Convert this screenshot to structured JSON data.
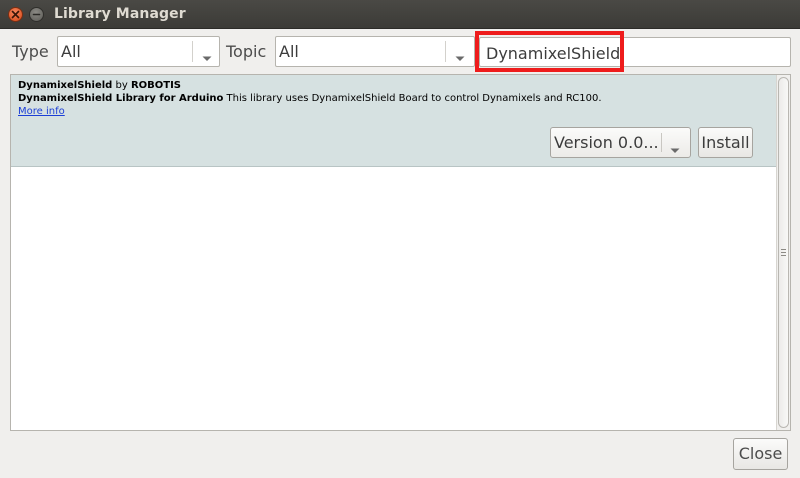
{
  "window": {
    "title": "Library Manager"
  },
  "filters": {
    "type_label": "Type",
    "type_value": "All",
    "topic_label": "Topic",
    "topic_value": "All",
    "search_value": "DynamixelShield"
  },
  "library": {
    "name": "DynamixelShield",
    "by": " by ",
    "author": "ROBOTIS",
    "sentence": "DynamixelShield Library for Arduino",
    "description": " This library uses DynamixelShield Board to control Dynamixels and RC100.",
    "more_info": "More info",
    "version_selected": "Version 0.0...",
    "install_label": "Install"
  },
  "footer": {
    "close_label": "Close"
  },
  "colors": {
    "highlight_box": "#ee1c1c",
    "selected_row": "#d6e1e1",
    "link": "#1c3fd6",
    "titlebar": "#3c3b37"
  },
  "icons": [
    "window-close-icon",
    "window-minimize-icon",
    "chevron-down-icon"
  ]
}
